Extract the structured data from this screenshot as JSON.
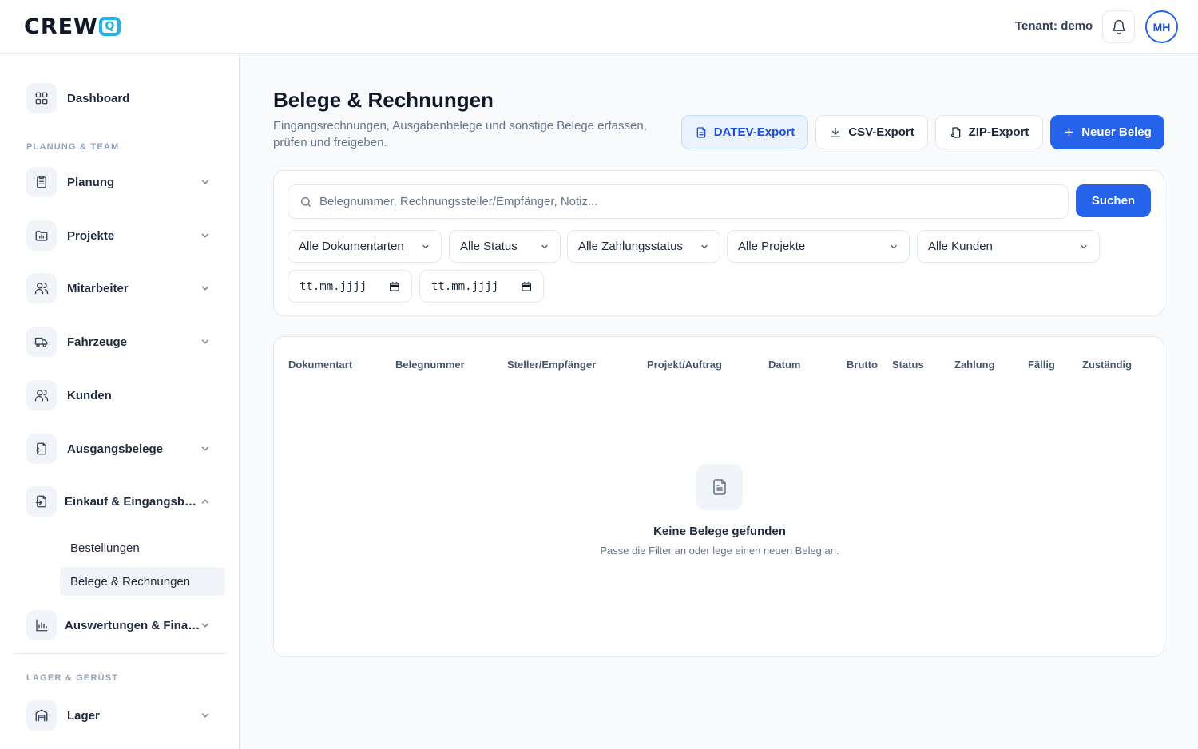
{
  "header": {
    "logo_text": "CREW",
    "logo_q": "Q",
    "tenant": "Tenant: demo",
    "avatar": "MH",
    "accent_color": "#2563eb",
    "logo_color": "#22b3e6"
  },
  "sidebar": {
    "dashboard": "Dashboard",
    "section_planning": "PLANUNG & TEAM",
    "items": [
      {
        "label": "Planung",
        "icon": "clipboard-icon"
      },
      {
        "label": "Projekte",
        "icon": "folder-chart-icon"
      },
      {
        "label": "Mitarbeiter",
        "icon": "users-icon"
      },
      {
        "label": "Fahrzeuge",
        "icon": "truck-icon"
      },
      {
        "label": "Kunden",
        "icon": "users-icon"
      },
      {
        "label": "Ausgangsbelege",
        "icon": "file-export-icon"
      },
      {
        "label": "Einkauf & Eingangsbelege",
        "icon": "file-import-icon"
      },
      {
        "label": "Auswertungen & Finanzen",
        "icon": "bar-chart-icon"
      }
    ],
    "sub_items": [
      "Bestellungen",
      "Belege & Rechnungen"
    ],
    "section_storage": "LAGER & GERÜST",
    "storage_items": [
      {
        "label": "Lager",
        "icon": "warehouse-icon"
      }
    ]
  },
  "main": {
    "title": "Belege & Rechnungen",
    "subtitle": "Eingangsrechnungen, Ausgabenbelege und sonstige Belege erfassen, prüfen und freigeben.",
    "buttons": {
      "datev": "DATEV-Export",
      "csv": "CSV-Export",
      "zip": "ZIP-Export",
      "new": "Neuer Beleg"
    },
    "search": {
      "placeholder": "Belegnummer, Rechnungssteller/Empfänger, Notiz...",
      "button": "Suchen"
    },
    "filters": [
      "Alle Dokumentarten",
      "Alle Status",
      "Alle Zahlungsstatus",
      "Alle Projekte",
      "Alle Kunden"
    ],
    "date_from": "tt.mm.jjjj",
    "date_to": "tt.mm.jjjj",
    "table": {
      "columns": [
        "Dokumentart",
        "Belegnummer",
        "Steller/Empfänger",
        "Projekt/Auftrag",
        "Datum",
        "Brutto",
        "Status",
        "Zahlung",
        "Fällig",
        "Zuständig"
      ],
      "empty_title": "Keine Belege gefunden",
      "empty_sub": "Passe die Filter an oder lege einen neuen Beleg an."
    }
  }
}
